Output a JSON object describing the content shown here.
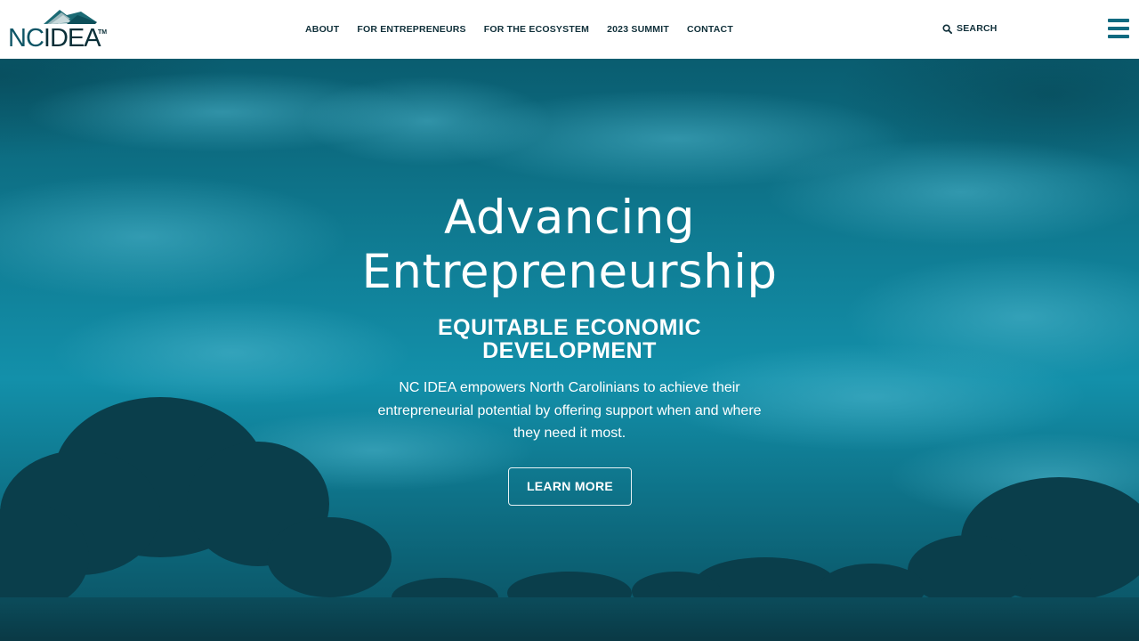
{
  "header": {
    "logo": {
      "text_nc": "NC",
      "text_idea": "IDEA",
      "tm": "TM",
      "alt": "NC IDEA"
    },
    "nav": [
      {
        "label": "ABOUT"
      },
      {
        "label": "FOR ENTREPRENEURS"
      },
      {
        "label": "FOR THE ECOSYSTEM"
      },
      {
        "label": "2023 SUMMIT"
      },
      {
        "label": "CONTACT"
      }
    ],
    "search_label": "SEARCH",
    "icons": {
      "search": "search-icon",
      "menu": "hamburger-menu-icon"
    }
  },
  "hero": {
    "title_line1": "Advancing",
    "title_line2": "Entrepreneurship",
    "subtitle": "EQUITABLE ECONOMIC DEVELOPMENT",
    "body": "NC IDEA empowers North Carolinians to achieve their entrepreneurial potential by offering support when and where they need it most.",
    "cta_label": "LEARN MORE"
  },
  "colors": {
    "brand_teal": "#0e6a80",
    "nav_text": "#10303a",
    "hero_overlay": "#0f7a91",
    "white": "#ffffff"
  }
}
